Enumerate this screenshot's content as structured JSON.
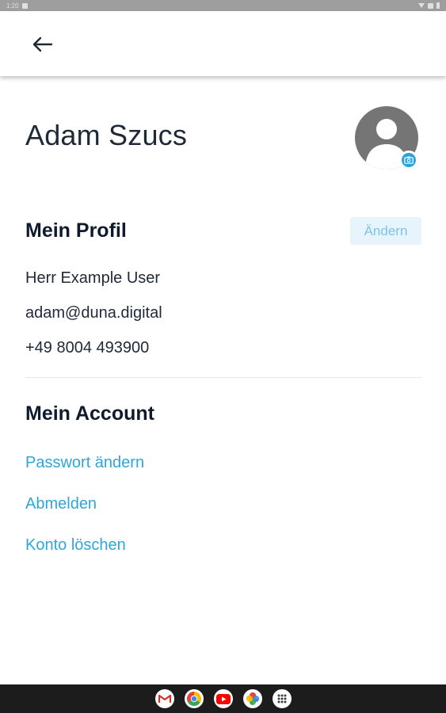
{
  "status_bar": {
    "time": "1:20"
  },
  "app_bar": {
    "back_icon": "arrow-left-icon"
  },
  "profile": {
    "name": "Adam Szucs",
    "avatar_icon": "person-placeholder-icon",
    "camera_icon": "camera-icon"
  },
  "my_profile": {
    "title": "Mein Profil",
    "edit_label": "Ändern",
    "salutation_name": "Herr Example User",
    "email": "adam@duna.digital",
    "phone": "+49 8004 493900"
  },
  "my_account": {
    "title": "Mein Account",
    "links": [
      "Passwort ändern",
      "Abmelden",
      "Konto löschen"
    ]
  },
  "dock": {
    "apps": [
      "gmail-icon",
      "chrome-icon",
      "youtube-icon",
      "photos-icon",
      "app-drawer-icon"
    ]
  },
  "colors": {
    "accent": "#2ea6da",
    "edit_button_bg": "#e8f4fb",
    "heading": "#0f1b2d",
    "avatar_bg": "#757575"
  }
}
